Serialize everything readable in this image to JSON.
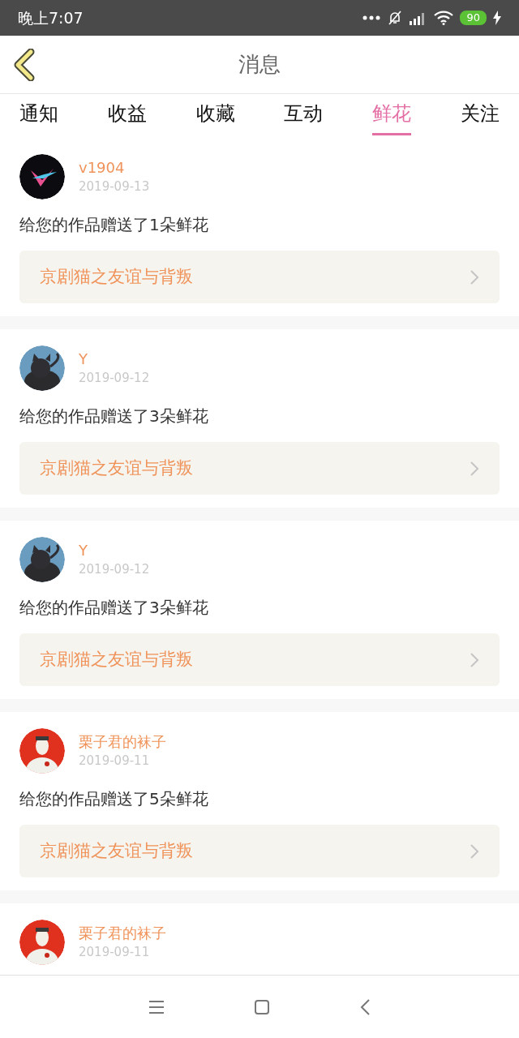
{
  "status_bar": {
    "time": "晚上7:07",
    "battery": "90"
  },
  "header": {
    "title": "消息"
  },
  "tabs": [
    {
      "label": "通知",
      "selected": false
    },
    {
      "label": "收益",
      "selected": false
    },
    {
      "label": "收藏",
      "selected": false
    },
    {
      "label": "互动",
      "selected": false
    },
    {
      "label": "鲜花",
      "selected": true
    },
    {
      "label": "关注",
      "selected": false
    }
  ],
  "messages": [
    {
      "name": "v1904",
      "date": "2019-09-13",
      "text": "给您的作品赠送了1朵鲜花",
      "work": "京剧猫之友谊与背叛"
    },
    {
      "name": "Y",
      "date": "2019-09-12",
      "text": "给您的作品赠送了3朵鲜花",
      "work": "京剧猫之友谊与背叛"
    },
    {
      "name": "Y",
      "date": "2019-09-12",
      "text": "给您的作品赠送了3朵鲜花",
      "work": "京剧猫之友谊与背叛"
    },
    {
      "name": "栗子君的袜子",
      "date": "2019-09-11",
      "text": "给您的作品赠送了5朵鲜花",
      "work": "京剧猫之友谊与背叛"
    },
    {
      "name": "栗子君的袜子",
      "date": "2019-09-11"
    }
  ]
}
